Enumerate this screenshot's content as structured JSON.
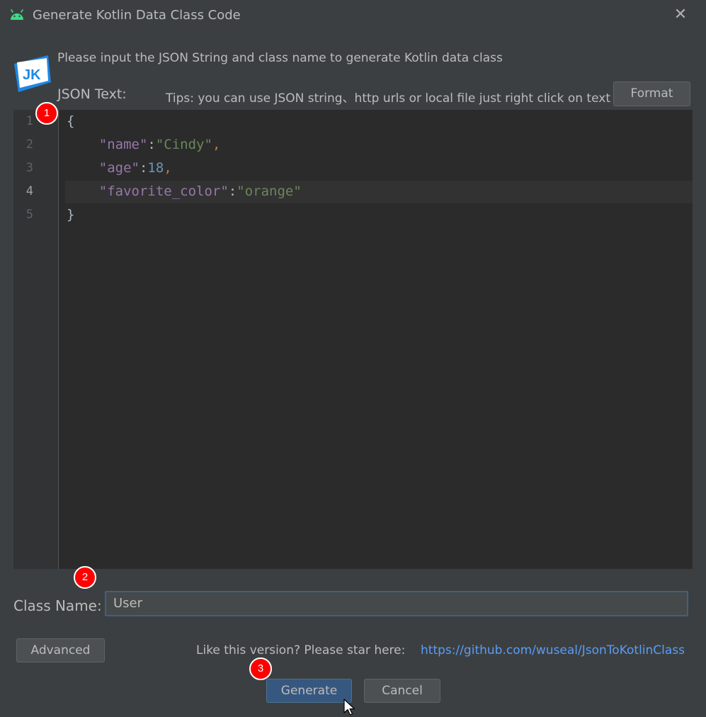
{
  "dialog": {
    "title": "Generate Kotlin Data Class Code",
    "close_glyph": "✕"
  },
  "header": {
    "logo_text": "JK",
    "prompt": "Please input the JSON String and class name to generate Kotlin data class",
    "json_label": "JSON Text:",
    "json_tips": "Tips: you can use JSON string、http urls or local file just right click on text area",
    "format_label": "Format"
  },
  "editor": {
    "line_numbers": [
      "1",
      "2",
      "3",
      "4",
      "5"
    ],
    "current_line": 4,
    "lines": [
      [
        {
          "t": "{",
          "c": "plain"
        }
      ],
      [
        {
          "t": "    ",
          "c": "plain"
        },
        {
          "t": "\"name\"",
          "c": "key"
        },
        {
          "t": ":",
          "c": "plain"
        },
        {
          "t": "\"Cindy\"",
          "c": "string"
        },
        {
          "t": ",",
          "c": "punct"
        }
      ],
      [
        {
          "t": "    ",
          "c": "plain"
        },
        {
          "t": "\"age\"",
          "c": "key"
        },
        {
          "t": ":",
          "c": "plain"
        },
        {
          "t": "18",
          "c": "number"
        },
        {
          "t": ",",
          "c": "punct"
        }
      ],
      [
        {
          "t": "    ",
          "c": "plain"
        },
        {
          "t": "\"favorite_color\"",
          "c": "key"
        },
        {
          "t": ":",
          "c": "plain"
        },
        {
          "t": "\"orange\"",
          "c": "string"
        }
      ],
      [
        {
          "t": "}",
          "c": "plain"
        }
      ]
    ]
  },
  "class_name": {
    "label": "Class Name:",
    "value": "User"
  },
  "footer": {
    "advanced_label": "Advanced",
    "star_text": "Like this version? Please star here:",
    "star_link": "https://github.com/wuseal/JsonToKotlinClass",
    "generate_label": "Generate",
    "cancel_label": "Cancel"
  },
  "annotations": {
    "badge_1": "1",
    "badge_2": "2",
    "badge_3": "3"
  },
  "colors": {
    "background": "#3c3f41",
    "editor_bg": "#2b2b2b",
    "key": "#6a8759",
    "string": "#6a8759",
    "number": "#6897bb",
    "punct": "#cc7832",
    "link": "#589df6",
    "primary_button": "#365880",
    "badge": "#ff0000"
  },
  "icons": [
    "android-icon",
    "close-icon",
    "jk-logo-icon",
    "mouse-cursor-icon"
  ]
}
